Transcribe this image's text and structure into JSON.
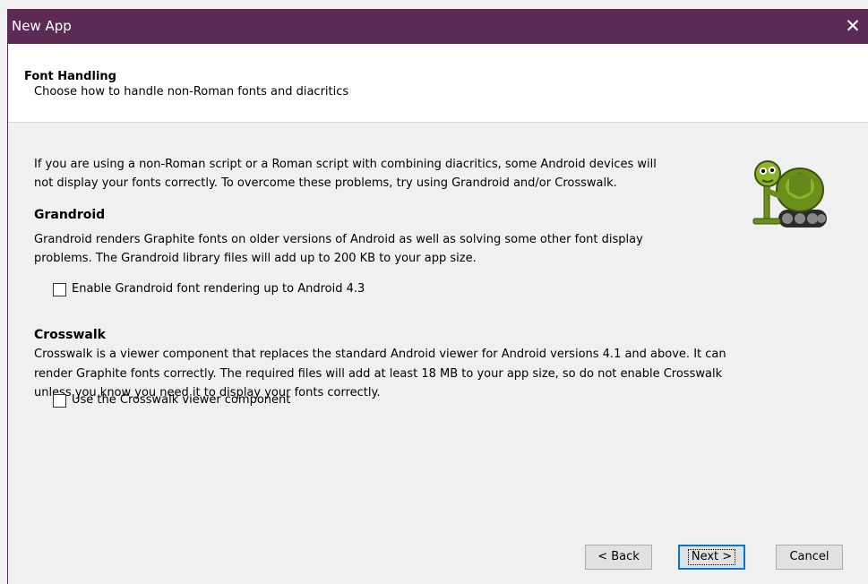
{
  "window": {
    "title": "New App",
    "close_glyph": "✕"
  },
  "header": {
    "title": "Font Handling",
    "subtitle": "Choose how to handle non-Roman fonts and diacritics"
  },
  "intro": {
    "lines": [
      "If you are using a non-Roman script or a Roman script with combining diacritics, some Android devices will",
      "not display your fonts correctly. To overcome these problems, try using Grandroid and/or Crosswalk."
    ]
  },
  "grandroid": {
    "title": "Grandroid",
    "lines": [
      "Grandroid renders Graphite fonts on older versions of Android as well as solving some other font display",
      "problems. The Grandroid library files will add up to 200 KB to your app size."
    ],
    "checkbox_label": "Enable Grandroid font rendering up to Android 4.3",
    "checked": false
  },
  "crosswalk": {
    "title": "Crosswalk",
    "lines": [
      "Crosswalk is a viewer component that replaces the standard Android viewer for Android versions 4.1 and above. It can",
      "render Graphite fonts correctly. The required files will add at least 18 MB to your app size, so do not enable Crosswalk",
      "unless you know you need it to display your fonts correctly."
    ],
    "checkbox_label": "Use the Crosswalk viewer component",
    "checked": false
  },
  "mascot": {
    "icon": "robot-turtle-mascot-icon"
  },
  "buttons": {
    "back": "< Back",
    "next": "Next >",
    "cancel": "Cancel"
  },
  "colors": {
    "titlebar": "#5b2a55",
    "dialog_bg": "#f0f0f0",
    "header_bg": "#ffffff",
    "default_button_border": "#0078d7"
  }
}
